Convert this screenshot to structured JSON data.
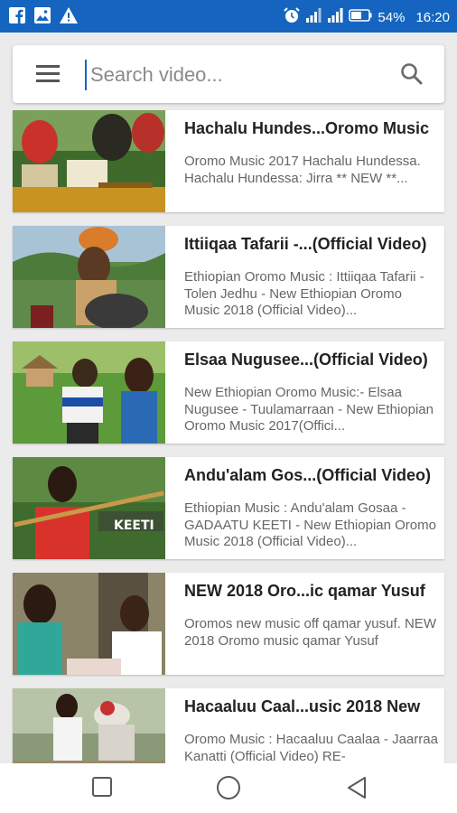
{
  "status_bar": {
    "battery": "54%",
    "time": "16:20",
    "color": "#1565c0",
    "left_icons": [
      "facebook-icon",
      "image-icon",
      "warning-icon"
    ],
    "right_icons": [
      "alarm-icon",
      "signal-icon",
      "signal-icon",
      "battery-icon"
    ]
  },
  "search": {
    "placeholder": "Search video...",
    "value": ""
  },
  "videos": [
    {
      "title": "Hachalu Hundes...Oromo Music",
      "description": "Oromo Music 2017 Hachalu Hundessa. Hachalu Hundessa: Jirra ** NEW **..."
    },
    {
      "title": "Ittiiqaa Tafarii -...(Official Video)",
      "description": "Ethiopian Oromo Music : Ittiiqaa Tafarii - Tolen Jedhu - New Ethiopian Oromo Music 2018 (Official Video)..."
    },
    {
      "title": "Elsaa Nugusee...(Official Video)",
      "description": "New Ethiopian Oromo Music:- Elsaa Nugusee - Tuulamarraan - New Ethiopian Oromo Music 2017(Offici..."
    },
    {
      "title": "Andu'alam Gos...(Official Video)",
      "description": "Ethiopian Music : Andu'alam Gosaa - GADAATU KEETI - New Ethiopian Oromo Music 2018 (Official Video)...",
      "thumb_caption": "KEETI"
    },
    {
      "title": "NEW 2018 Oro...ic qamar Yusuf",
      "description": "Oromos new music off qamar yusuf. NEW 2018 Oromo music qamar Yusuf"
    },
    {
      "title": "Hacaaluu Caal...usic 2018 New",
      "description": "Oromo Music : Hacaaluu Caalaa - Jaarraa Kanatti (Official Video) RE-"
    }
  ],
  "nav": [
    "recents-icon",
    "home-icon",
    "back-icon"
  ]
}
